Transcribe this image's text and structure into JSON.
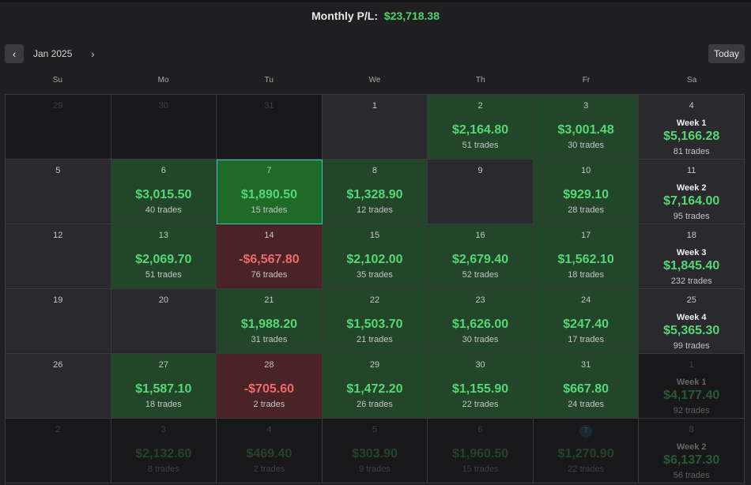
{
  "header": {
    "title_prefix": "Monthly P/L:",
    "total": "$23,718.38"
  },
  "nav": {
    "prev_icon": "‹",
    "month": "Jan 2025",
    "next_icon": "›",
    "today": "Today"
  },
  "weekdays": [
    "Su",
    "Mo",
    "Tu",
    "We",
    "Th",
    "Fr",
    "Sa"
  ],
  "rows": [
    [
      {
        "day": "29",
        "kind": "outside"
      },
      {
        "day": "30",
        "kind": "outside"
      },
      {
        "day": "31",
        "kind": "outside"
      },
      {
        "day": "1",
        "kind": "plain"
      },
      {
        "day": "2",
        "kind": "pos",
        "pnl": "$2,164.80",
        "trades": "51 trades"
      },
      {
        "day": "3",
        "kind": "pos",
        "pnl": "$3,001.48",
        "trades": "30 trades"
      },
      {
        "day": "4",
        "kind": "week",
        "week": "Week 1",
        "total": "$5,166.28",
        "trades": "81 trades"
      }
    ],
    [
      {
        "day": "5",
        "kind": "plain"
      },
      {
        "day": "6",
        "kind": "pos",
        "pnl": "$3,015.50",
        "trades": "40 trades"
      },
      {
        "day": "7",
        "kind": "sel",
        "pnl": "$1,890.50",
        "trades": "15 trades"
      },
      {
        "day": "8",
        "kind": "pos",
        "pnl": "$1,328.90",
        "trades": "12 trades"
      },
      {
        "day": "9",
        "kind": "plain"
      },
      {
        "day": "10",
        "kind": "pos",
        "pnl": "$929.10",
        "trades": "28 trades"
      },
      {
        "day": "11",
        "kind": "week",
        "week": "Week 2",
        "total": "$7,164.00",
        "trades": "95 trades"
      }
    ],
    [
      {
        "day": "12",
        "kind": "plain"
      },
      {
        "day": "13",
        "kind": "pos",
        "pnl": "$2,069.70",
        "trades": "51 trades"
      },
      {
        "day": "14",
        "kind": "neg",
        "pnl": "-$6,567.80",
        "trades": "76 trades"
      },
      {
        "day": "15",
        "kind": "pos",
        "pnl": "$2,102.00",
        "trades": "35 trades"
      },
      {
        "day": "16",
        "kind": "pos",
        "pnl": "$2,679.40",
        "trades": "52 trades"
      },
      {
        "day": "17",
        "kind": "pos",
        "pnl": "$1,562.10",
        "trades": "18 trades"
      },
      {
        "day": "18",
        "kind": "week",
        "week": "Week 3",
        "total": "$1,845.40",
        "trades": "232 trades"
      }
    ],
    [
      {
        "day": "19",
        "kind": "plain"
      },
      {
        "day": "20",
        "kind": "plain"
      },
      {
        "day": "21",
        "kind": "pos",
        "pnl": "$1,988.20",
        "trades": "31 trades"
      },
      {
        "day": "22",
        "kind": "pos",
        "pnl": "$1,503.70",
        "trades": "21 trades"
      },
      {
        "day": "23",
        "kind": "pos",
        "pnl": "$1,626.00",
        "trades": "30 trades"
      },
      {
        "day": "24",
        "kind": "pos",
        "pnl": "$247.40",
        "trades": "17 trades"
      },
      {
        "day": "25",
        "kind": "week",
        "week": "Week 4",
        "total": "$5,365.30",
        "trades": "99 trades"
      }
    ],
    [
      {
        "day": "26",
        "kind": "plain"
      },
      {
        "day": "27",
        "kind": "pos",
        "pnl": "$1,587.10",
        "trades": "18 trades"
      },
      {
        "day": "28",
        "kind": "neg",
        "pnl": "-$705.60",
        "trades": "2 trades"
      },
      {
        "day": "29",
        "kind": "pos",
        "pnl": "$1,472.20",
        "trades": "26 trades"
      },
      {
        "day": "30",
        "kind": "pos",
        "pnl": "$1,155.90",
        "trades": "22 trades"
      },
      {
        "day": "31",
        "kind": "pos",
        "pnl": "$667.80",
        "trades": "24 trades"
      },
      {
        "day": "1",
        "kind": "weekdim",
        "week": "Week 1",
        "total": "$4,177.40",
        "trades": "92 trades"
      }
    ],
    [
      {
        "day": "2",
        "kind": "outside"
      },
      {
        "day": "3",
        "kind": "outsidepnl",
        "pnl": "$2,132.60",
        "trades": "8 trades"
      },
      {
        "day": "4",
        "kind": "outsidepnl",
        "pnl": "$469.40",
        "trades": "2 trades"
      },
      {
        "day": "5",
        "kind": "outsidepnl",
        "pnl": "$303.90",
        "trades": "9 trades"
      },
      {
        "day": "6",
        "kind": "outsidepnl",
        "pnl": "$1,960.50",
        "trades": "15 trades"
      },
      {
        "day": "7",
        "kind": "outsidepnl",
        "pnl": "$1,270.90",
        "trades": "22 trades",
        "circle": true
      },
      {
        "day": "8",
        "kind": "weekdim",
        "week": "Week 2",
        "total": "$6,137.30",
        "trades": "56 trades"
      }
    ]
  ]
}
